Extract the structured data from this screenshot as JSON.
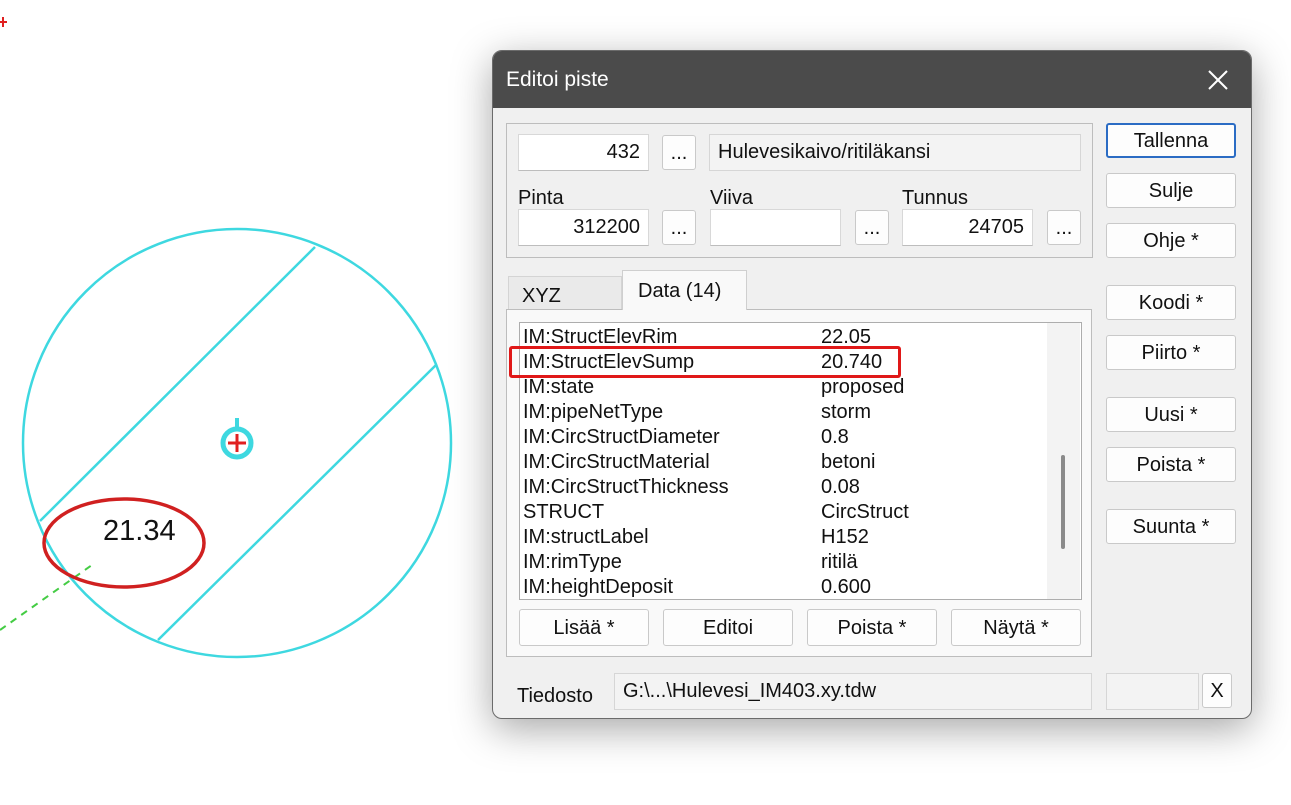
{
  "canvas": {
    "label": "21.34",
    "colors": {
      "circle": "#3ed8e0",
      "marker": "#e02020",
      "annotation": "#d02020",
      "dashed": "#44cc44"
    }
  },
  "dialog": {
    "title": "Editoi piste",
    "number": "432",
    "description": "Hulevesikaivo/ritiläkansi",
    "pinta_label": "Pinta",
    "pinta_value": "312200",
    "viiva_label": "Viiva",
    "viiva_value": "",
    "tunnus_label": "Tunnus",
    "tunnus_value": "24705",
    "browse_label": "...",
    "tabs": [
      "XYZ",
      "Data (14)"
    ],
    "data_rows": [
      {
        "key": "IM:StructElevRim",
        "value": "22.05"
      },
      {
        "key": "IM:StructElevSump",
        "value": "20.740"
      },
      {
        "key": "IM:state",
        "value": "proposed"
      },
      {
        "key": "IM:pipeNetType",
        "value": "storm"
      },
      {
        "key": "IM:CircStructDiameter",
        "value": "0.8"
      },
      {
        "key": "IM:CircStructMaterial",
        "value": "betoni"
      },
      {
        "key": "IM:CircStructThickness",
        "value": "0.08"
      },
      {
        "key": "STRUCT",
        "value": "CircStruct"
      },
      {
        "key": "IM:structLabel",
        "value": "H152"
      },
      {
        "key": "IM:rimType",
        "value": "ritilä"
      },
      {
        "key": "IM:heightDeposit",
        "value": "0.600"
      }
    ],
    "list_buttons": [
      "Lisää *",
      "Editoi",
      "Poista *",
      "Näytä *"
    ],
    "side_buttons": [
      "Tallenna",
      "Sulje",
      "Ohje *",
      "Koodi *",
      "Piirto *",
      "Uusi *",
      "Poista *",
      "Suunta *"
    ],
    "file_label": "Tiedosto",
    "file_value": "G:\\...\\Hulevesi_IM403.xy.tdw",
    "clear_label": "X",
    "highlight_color": "#e01818"
  }
}
